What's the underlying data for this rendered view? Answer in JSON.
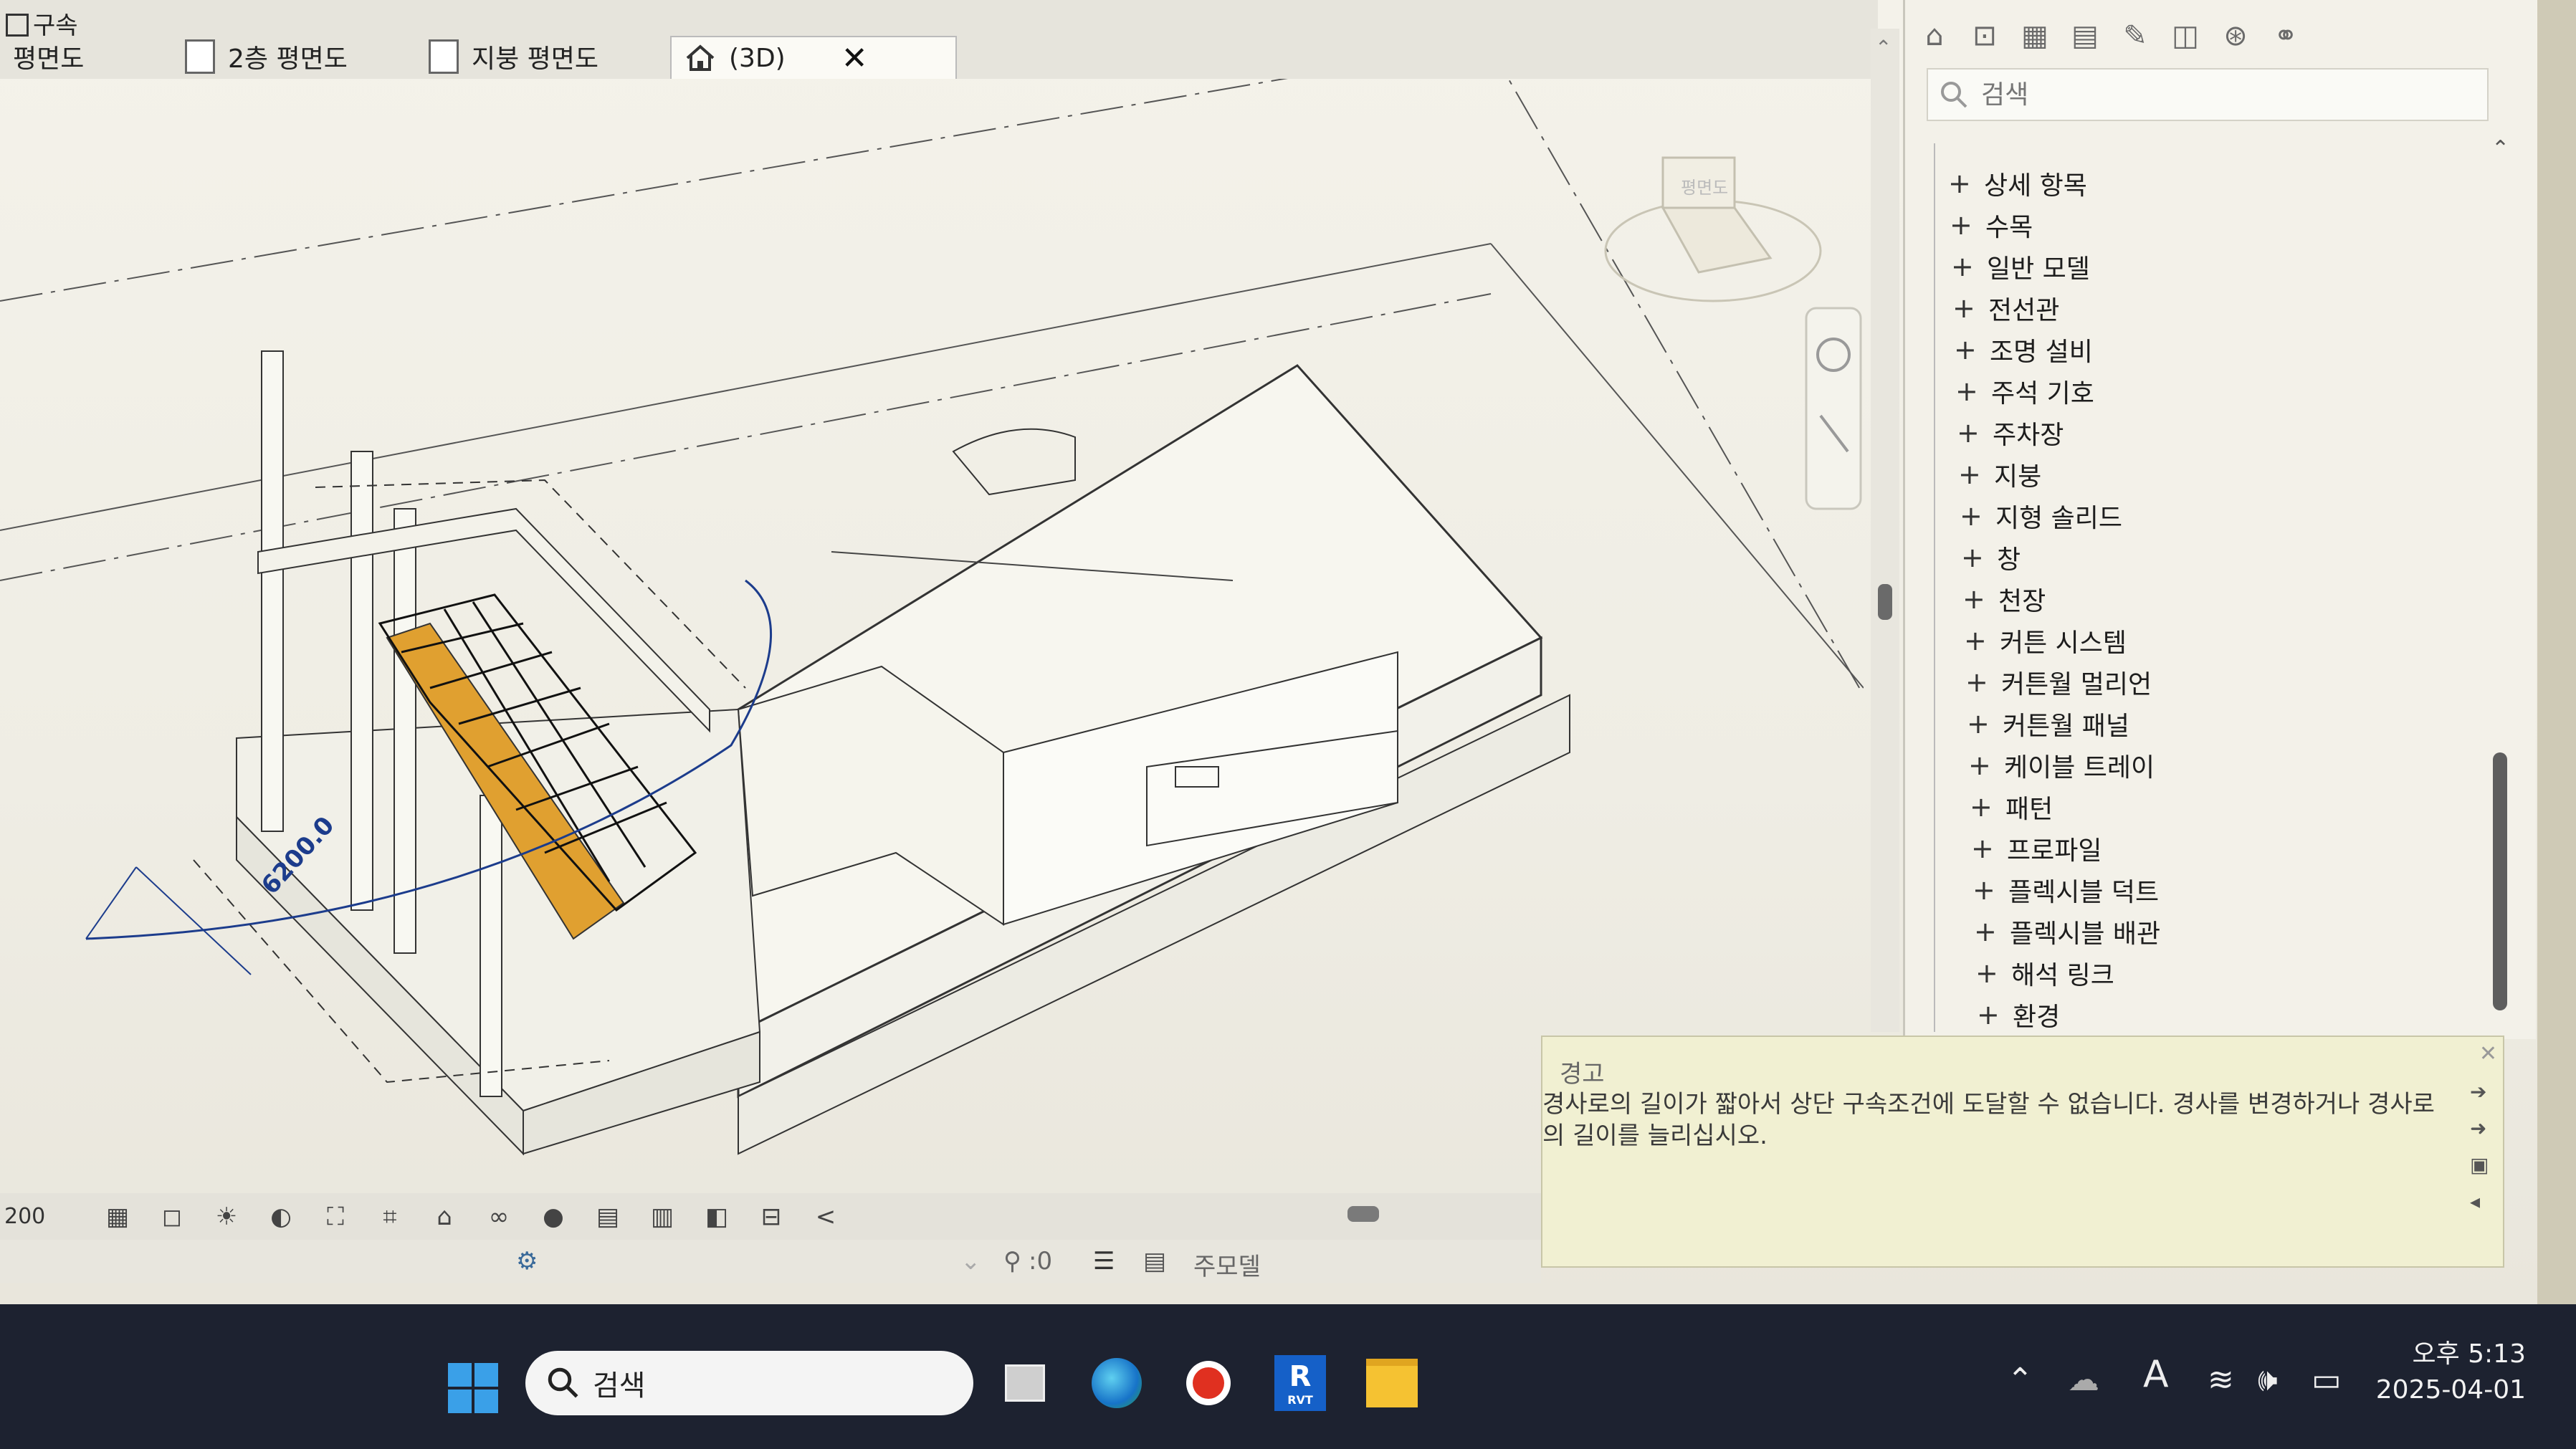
{
  "tabs": {
    "top_label": "구속",
    "items": [
      {
        "label": "평면도"
      },
      {
        "label": "2층 평면도"
      },
      {
        "label": "지붕 평면도"
      },
      {
        "label": "(3D)"
      }
    ],
    "close_symbol": "✕"
  },
  "drawing": {
    "dimension_text": "6200.0",
    "viewcube_label": "평면도"
  },
  "view_controls": {
    "scale_text": "200",
    "collapse_symbol": "<"
  },
  "status": {
    "count_text": ":0",
    "model_label": "주모델"
  },
  "browser_panel": {
    "search_placeholder": "검색",
    "items": [
      "상세 항목",
      "수목",
      "일반 모델",
      "전선관",
      "조명 설비",
      "주석 기호",
      "주차장",
      "지붕",
      "지형 솔리드",
      "창",
      "천장",
      "커튼 시스템",
      "커튼월 멀리언",
      "커튼월 패널",
      "케이블 트레이",
      "패턴",
      "프로파일",
      "플렉시블 덕트",
      "플렉시블 배관",
      "해석 링크",
      "환경"
    ]
  },
  "warning": {
    "title": "경고",
    "message": "경사로의 길이가 짧아서 상단 구속조건에 도달할 수 없습니다. 경사를 변경하거나 경사로의 길이를 늘리십시오."
  },
  "taskbar": {
    "search_label": "검색",
    "revit_label": "R",
    "revit_sub": "RVT",
    "time": "오후 5:13",
    "date": "2025-04-01"
  },
  "colors": {
    "accent_orange": "#e0a030",
    "dimension_blue": "#1c3c8c",
    "taskbar_bg": "#1d2230",
    "warning_bg": "#f1f0d2"
  },
  "icons": {
    "toolbar": [
      "home-icon",
      "zoom-icon",
      "schedule-icon",
      "table-icon",
      "brush-icon",
      "sheet-icon",
      "family-icon",
      "link-icon"
    ],
    "view_controls": [
      "detail-level-icon",
      "visual-style-icon",
      "sun-path-icon",
      "shadows-icon",
      "crop-icon",
      "show-crop-icon",
      "unlock-view-icon",
      "temp-hide-icon",
      "reveal-hidden-icon",
      "light-bulb-icon",
      "worksharing-icon",
      "highlight-icon",
      "analytical-icon",
      "reveal-constraints-icon"
    ]
  }
}
